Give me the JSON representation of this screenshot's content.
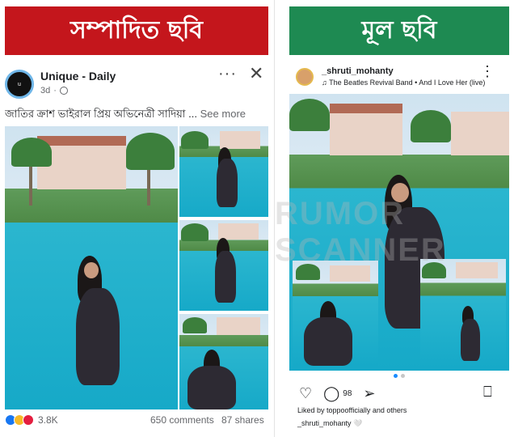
{
  "banners": {
    "edited_label": "সম্পাদিত ছবি",
    "original_label": "মূল ছবি",
    "edited_color": "#c4161c",
    "original_color": "#1e8a52"
  },
  "facebook_post": {
    "page_name": "Unique - Daily",
    "time_ago": "3d",
    "avatar_text": "u",
    "more_icon": "more-horizontal-icon",
    "close_icon": "close-icon",
    "caption": "জাতির ক্রাশ ভাইরাল প্রিয় অভিনেত্রী সাদিয়া ... ",
    "see_more": "See more",
    "reactions_count": "3.8K",
    "comments": "650 comments",
    "shares": "87 shares"
  },
  "instagram_post": {
    "username": "_shruti_mohanty",
    "audio": "♫ The Beatles Revival Band • And I Love Her (live)",
    "comment_count": "98",
    "liked_by": "Liked by toppoofficially and others",
    "caption_user": "_shruti_mohanty 🤍"
  },
  "watermark": "RUMOR SCANNER"
}
